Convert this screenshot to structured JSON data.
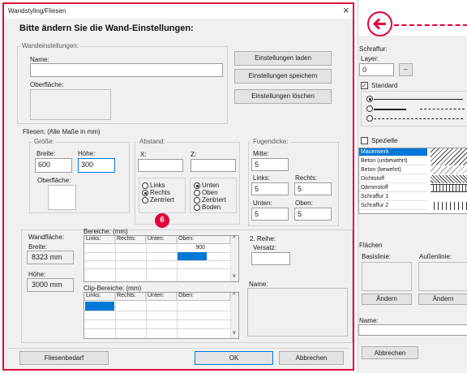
{
  "window": {
    "title": "Wandstyling/Fliesen",
    "close_glyph": "×",
    "heading": "Bitte ändern Sie die Wand-Einstellungen:"
  },
  "wall": {
    "group": "Wandeinstellungen:",
    "name_label": "Name:",
    "name_value": "",
    "surface_label": "Oberfläche:",
    "btn_load": "Einstellungen laden",
    "btn_save": "Einstellungen speichern",
    "btn_delete": "Einstellungen löschen"
  },
  "tiles": {
    "section": "Fliesen: (Alle Maße in mm)",
    "size": {
      "group": "Größe:",
      "width_label": "Breite:",
      "width_value": "600",
      "height_label": "Höhe:",
      "height_value": "300",
      "surface_label": "Oberfläche:"
    },
    "spacing": {
      "group": "Abstand:",
      "x_label": "X:",
      "x_value": "",
      "z_label": "Z:",
      "z_value": "",
      "h_options": [
        "Links",
        "Rechts",
        "Zentriert"
      ],
      "v_options": [
        "Unten",
        "Oben",
        "Zentriert",
        "Boden"
      ]
    },
    "joints": {
      "group": "Fugendicke:",
      "middle_label": "Mitte:",
      "middle_value": "5",
      "left_label": "Links:",
      "left_value": "5",
      "right_label": "Rechts:",
      "right_value": "5",
      "bottom_label": "Unten:",
      "bottom_value": "5",
      "top_label": "Oben:",
      "top_value": "5"
    },
    "badge": "6",
    "wallarea": {
      "label": "Wandfläche:",
      "width_label": "Breite:",
      "width_value": "8323 mm",
      "height_label": "Höhe:",
      "height_value": "3000 mm"
    },
    "areas": {
      "label": "Bereiche: (mm)",
      "columns": [
        "Links:",
        "Rechts:",
        "Unten:",
        "Oben:"
      ],
      "value_cell": "900"
    },
    "clip": {
      "label": "Clip-Bereiche: (mm)",
      "columns": [
        "Links:",
        "Rechts:",
        "Unten:",
        "Oben:"
      ]
    },
    "row2": {
      "label": "2. Reihe:",
      "offset_label": "Versatz:",
      "offset_value": ""
    },
    "name_label": "Name:"
  },
  "footer": {
    "btn_tiles": "Fliesenbedarf",
    "btn_ok": "OK",
    "btn_cancel": "Abbrechen"
  },
  "right_panel": {
    "hatch_label": "Schraffur:",
    "layer_label": "Layer:",
    "layer_value": "0",
    "minus": "–",
    "standard_label": "Standard",
    "special_label": "Spezielle",
    "hatch_items": [
      "Mauerwerk",
      "Beton (unbewehrt)",
      "Beton (bewehrt)",
      "Dichtstoff",
      "Dämmstoff",
      "Schraffur 1",
      "Schraffur 2"
    ],
    "areas_label": "Flächen",
    "base_label": "Basislinie:",
    "outer_label": "Außenlinie:",
    "change1": "Ändern",
    "change2": "Ändern",
    "name_label": "Name:",
    "cancel": "Abbrechen"
  },
  "colors": {
    "accent_red": "#e4003a",
    "selection": "#0078d7"
  }
}
